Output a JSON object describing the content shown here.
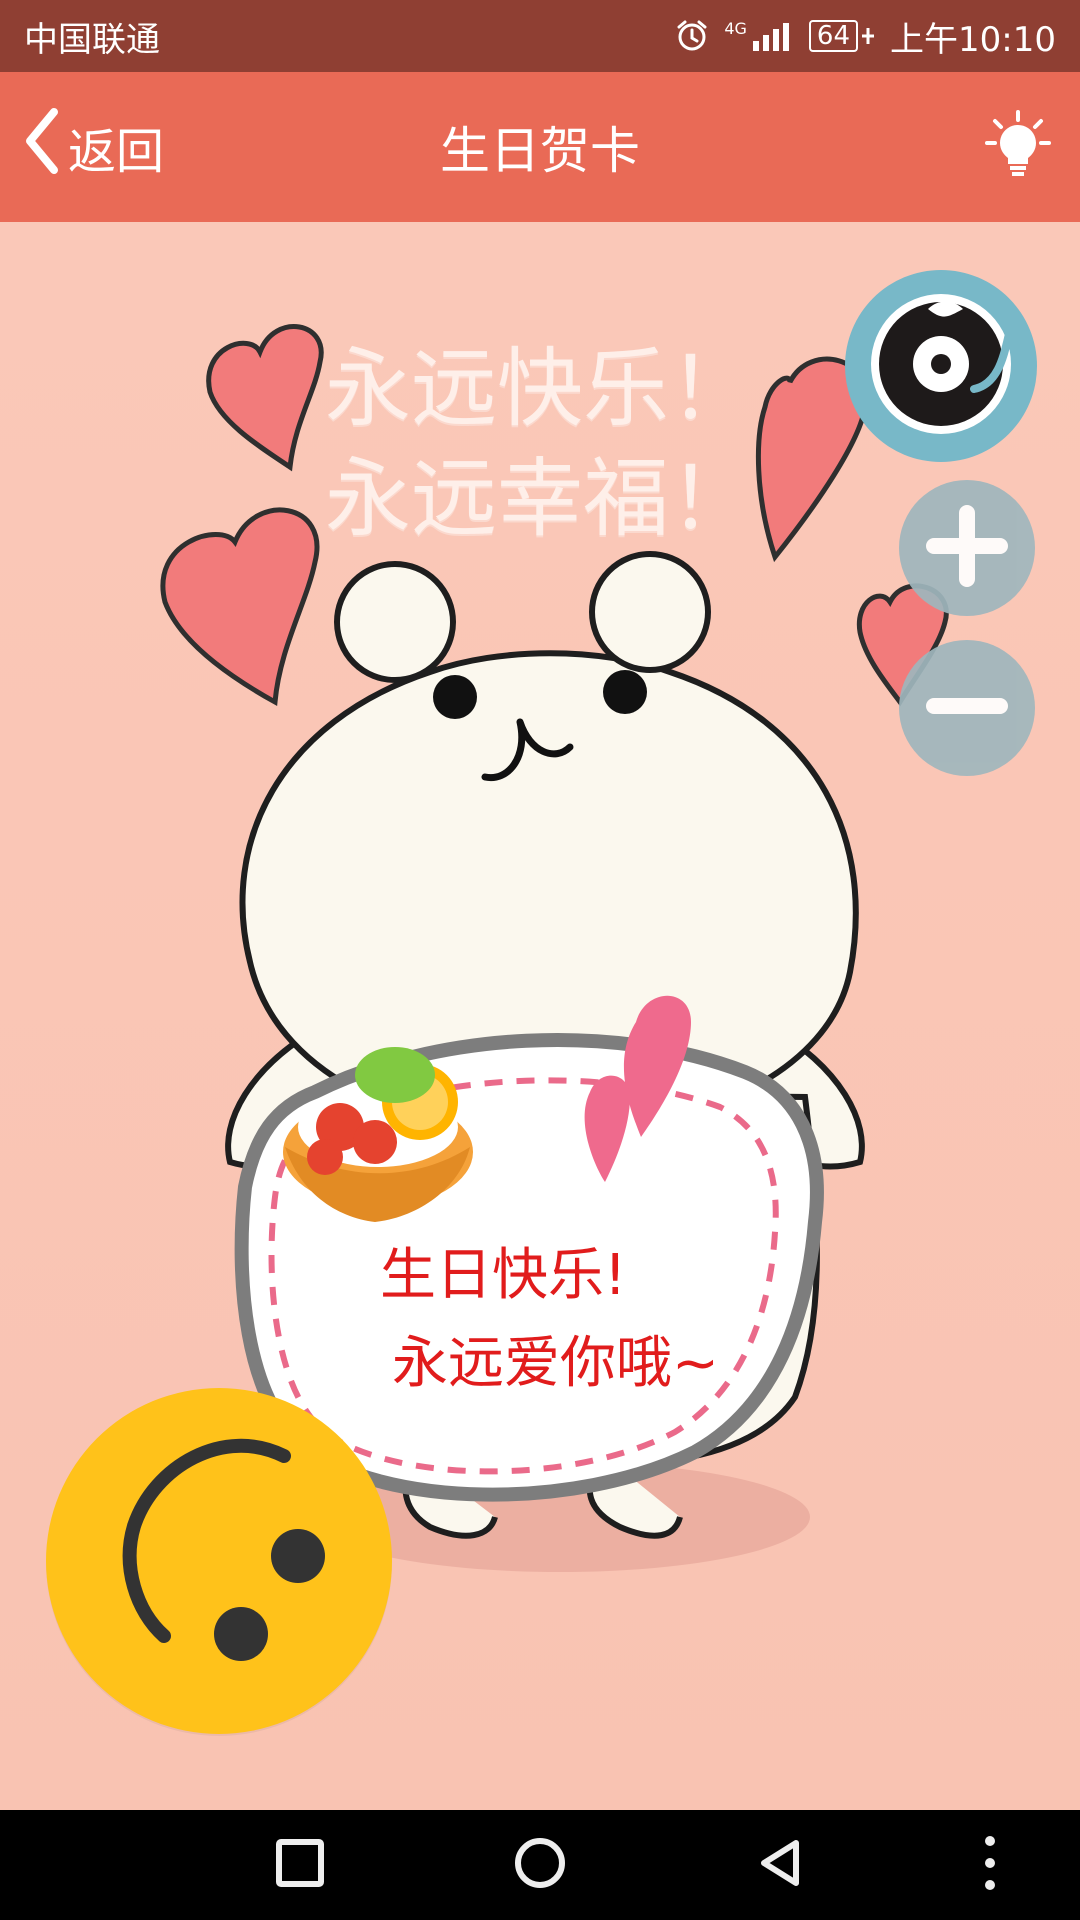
{
  "status_bar": {
    "carrier": "中国联通",
    "network": "4G",
    "battery": "64",
    "time": "上午10:10"
  },
  "header": {
    "back_label": "返回",
    "title": "生日贺卡"
  },
  "card": {
    "headline_lines": [
      "永远快乐！",
      "永远幸福！"
    ],
    "bubble_lines": [
      "生日快乐!",
      "永远爱你哦~"
    ]
  },
  "colors": {
    "status_bar": "#8f3f33",
    "header": "#e96a56",
    "card_bg": "#f9c6b4",
    "heart": "#f27b7b",
    "bubble_text": "#e11c1c",
    "music_ring": "#78b8c8",
    "zoom_buttons": "#9fb6bd",
    "float_ball": "#ffc21a",
    "nav_bar": "#000000"
  },
  "icons": {
    "back": "chevron-left-icon",
    "bulb": "lightbulb-icon",
    "music": "music-disc-icon",
    "plus": "plus-icon",
    "minus": "minus-icon",
    "floating_ball": "smiley-icon",
    "nav_recent": "square-icon",
    "nav_home": "circle-icon",
    "nav_back": "triangle-back-icon",
    "nav_more": "more-vertical-icon"
  }
}
